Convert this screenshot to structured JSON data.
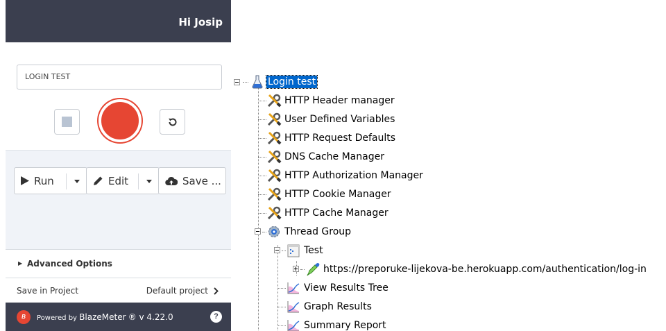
{
  "header": {
    "greeting": "Hi Josip"
  },
  "recorder": {
    "test_name": "LOGIN TEST"
  },
  "actions": {
    "run_label": "Run",
    "edit_label": "Edit",
    "save_label": "Save ..."
  },
  "advanced": {
    "label": "Advanced Options"
  },
  "save_project": {
    "label": "Save in Project",
    "value": "Default project"
  },
  "footer": {
    "logo_text": "B",
    "powered_by": "Powered by",
    "brand": "BlazeMeter",
    "version": "® v 4.22.0",
    "help": "?"
  },
  "tree": {
    "root": {
      "label": "Login test",
      "icon": "flask-icon",
      "selected": true
    },
    "config_items": [
      {
        "label": "HTTP Header manager",
        "icon": "wrench-icon"
      },
      {
        "label": "User Defined Variables",
        "icon": "wrench-icon"
      },
      {
        "label": "HTTP Request Defaults",
        "icon": "wrench-icon"
      },
      {
        "label": "DNS Cache Manager",
        "icon": "wrench-icon"
      },
      {
        "label": "HTTP Authorization Manager",
        "icon": "wrench-icon"
      },
      {
        "label": "HTTP Cookie Manager",
        "icon": "wrench-icon"
      },
      {
        "label": "HTTP Cache Manager",
        "icon": "wrench-icon"
      }
    ],
    "thread_group": {
      "label": "Thread Group",
      "icon": "gear-icon"
    },
    "controller": {
      "label": "Test",
      "icon": "controller-icon"
    },
    "sampler": {
      "label": "https://preporuke-lijekova-be.herokuapp.com/authentication/log-in",
      "icon": "pipette-icon"
    },
    "listeners": [
      {
        "label": "View Results Tree",
        "icon": "graph-icon"
      },
      {
        "label": "Graph Results",
        "icon": "graph-icon"
      },
      {
        "label": "Summary Report",
        "icon": "graph-icon"
      }
    ]
  },
  "colors": {
    "panel_dark": "#3b3f4f",
    "record_red": "#e64633",
    "selection_blue": "#0066cc"
  }
}
